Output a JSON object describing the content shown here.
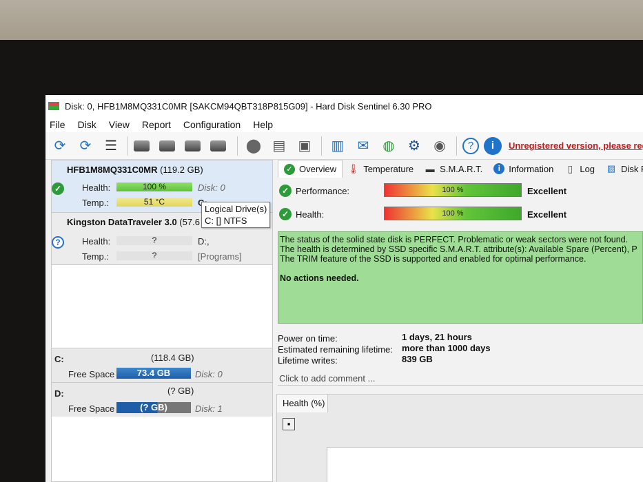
{
  "window": {
    "title": "Disk: 0, HFB1M8MQ331C0MR [SAKCM94QBT318P815G09]  -  Hard Disk Sentinel 6.30 PRO"
  },
  "menu": [
    "File",
    "Disk",
    "View",
    "Report",
    "Configuration",
    "Help"
  ],
  "toolbar": {
    "unregistered": "Unregistered version, please regis"
  },
  "disks": [
    {
      "name": "HFB1M8MQ331C0MR",
      "size": "(119.2 GB)",
      "health_label": "Health:",
      "health": "100 %",
      "health_value": 100,
      "disk": "Disk: 0",
      "temp_label": "Temp.:",
      "temp": "51 °C",
      "drive": "C:"
    },
    {
      "name": "Kingston DataTraveler 3.0",
      "size": "(57.6",
      "health_label": "Health:",
      "health": "?",
      "disk": "D:,",
      "temp_label": "Temp.:",
      "temp": "?",
      "drive": "[Programs]"
    }
  ],
  "tooltip": {
    "line1": "Logical Drive(s)",
    "line2": "C: [] NTFS"
  },
  "volumes": [
    {
      "letter": "C:",
      "size": "(118.4 GB)",
      "free_label": "Free Space",
      "free": "73.4 GB",
      "disk": "Disk: 0"
    },
    {
      "letter": "D:",
      "size": "(? GB)",
      "free_label": "Free Space",
      "free": "(? GB)",
      "disk": "Disk: 1"
    }
  ],
  "tabs": [
    "Overview",
    "Temperature",
    "S.M.A.R.T.",
    "Information",
    "Log",
    "Disk Perfor"
  ],
  "overview": {
    "performance_label": "Performance:",
    "performance": "100 %",
    "performance_value": 100,
    "performance_rating": "Excellent",
    "health_label": "Health:",
    "health": "100 %",
    "health_value": 100,
    "health_rating": "Excellent",
    "status_lines": [
      "The status of the solid state disk is PERFECT. Problematic or weak sectors were not found.",
      "The health is determined by SSD specific S.M.A.R.T. attribute(s):  Available Spare (Percent), P",
      "The TRIM feature of the SSD is supported and enabled for optimal performance.",
      "",
      "No actions needed."
    ],
    "power_on_label": "Power on time:",
    "power_on": "1 days, 21 hours",
    "lifetime_label": "Estimated remaining lifetime:",
    "lifetime": "more than 1000 days",
    "writes_label": "Lifetime writes:",
    "writes": "839 GB",
    "comment": "Click to add comment ...",
    "health_tab": "Health (%)"
  }
}
